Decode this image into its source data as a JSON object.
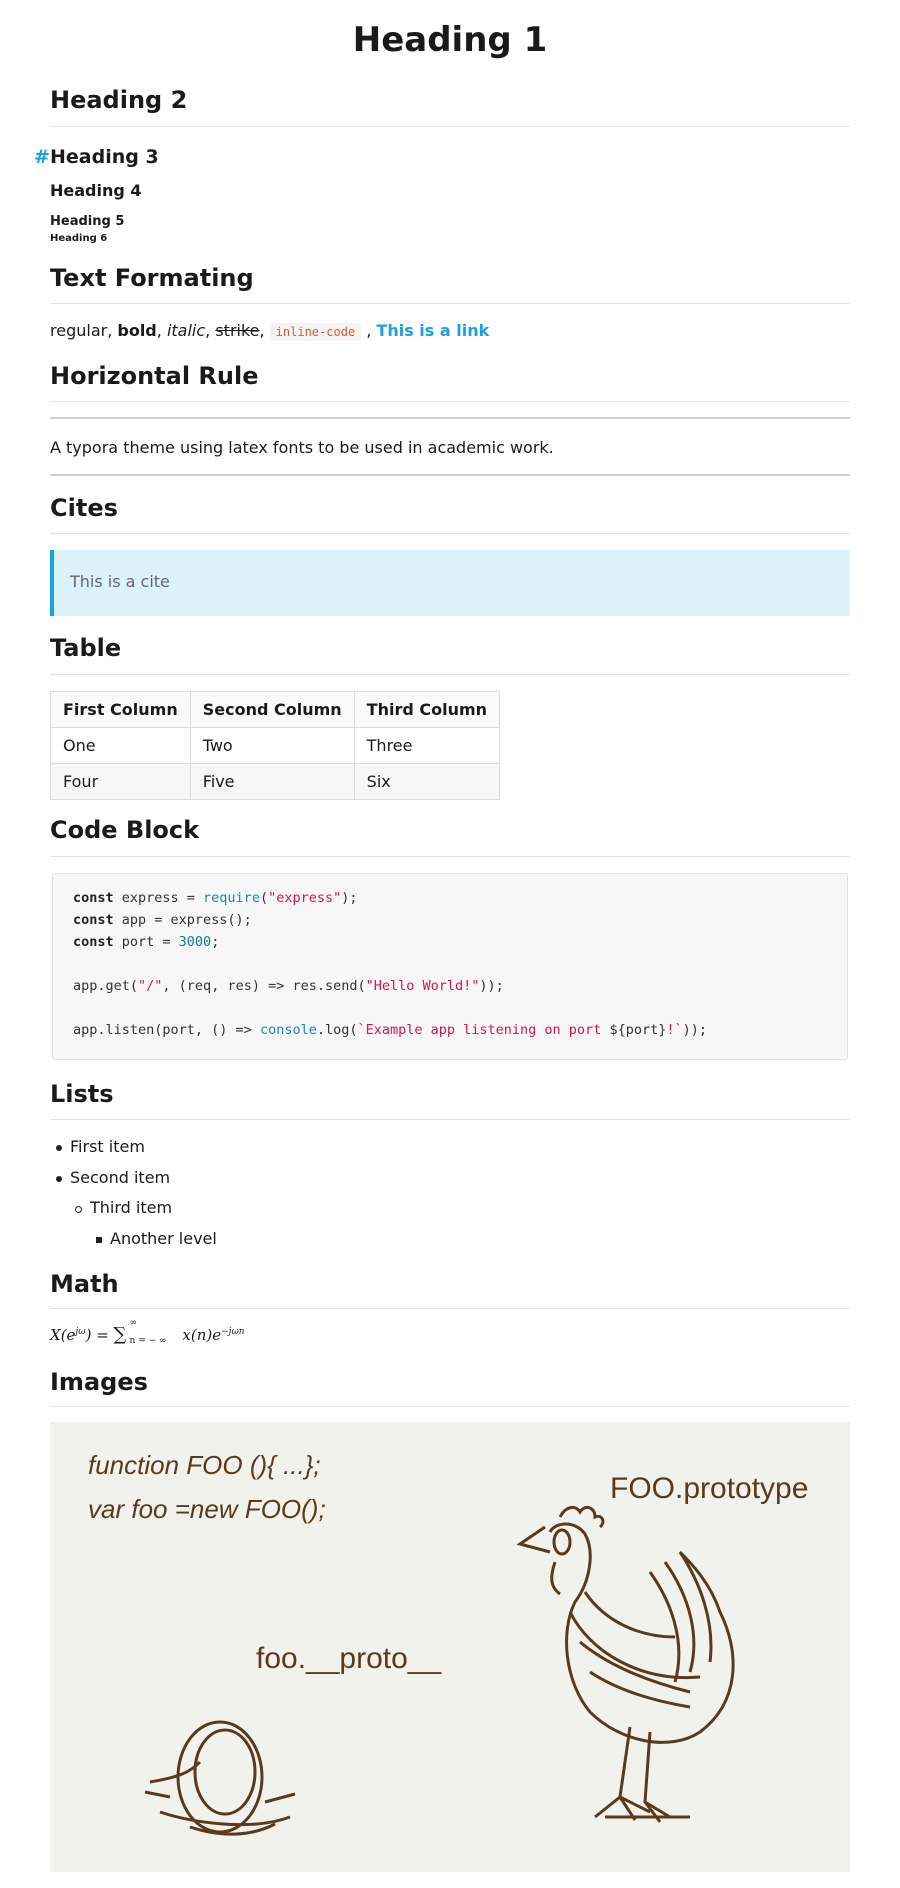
{
  "headings": {
    "h1": "Heading 1",
    "h2": "Heading 2",
    "h3": "Heading 3",
    "h3_anchor": "#",
    "h4": "Heading 4",
    "h5": "Heading 5",
    "h6": "Heading 6"
  },
  "text_formatting": {
    "title": "Text Formating",
    "regular": "regular, ",
    "bold": "bold",
    "sep1": ", ",
    "italic": "italic",
    "sep2": ", ",
    "strike": "strike",
    "sep3": ", ",
    "code": "inline-code",
    "sep4": " , ",
    "link": "This is a link"
  },
  "horizontal_rule": {
    "title": "Horizontal Rule",
    "paragraph": "A typora theme using latex fonts to be used in academic work."
  },
  "cites": {
    "title": "Cites",
    "quote": "This is a cite"
  },
  "table": {
    "title": "Table",
    "headers": [
      "First Column",
      "Second Column",
      "Third Column"
    ],
    "rows": [
      [
        "One",
        "Two",
        "Three"
      ],
      [
        "Four",
        "Five",
        "Six"
      ]
    ]
  },
  "code_block": {
    "title": "Code Block",
    "lines": [
      [
        {
          "t": "const",
          "c": "kw"
        },
        {
          "t": " express = "
        },
        {
          "t": "require",
          "c": "fn"
        },
        {
          "t": "("
        },
        {
          "t": "\"express\"",
          "c": "str"
        },
        {
          "t": ");"
        }
      ],
      [
        {
          "t": "const",
          "c": "kw"
        },
        {
          "t": " app = express();"
        }
      ],
      [
        {
          "t": "const",
          "c": "kw"
        },
        {
          "t": " port = "
        },
        {
          "t": "3000",
          "c": "num"
        },
        {
          "t": ";"
        }
      ],
      [],
      [
        {
          "t": "app.get("
        },
        {
          "t": "\"/\"",
          "c": "str"
        },
        {
          "t": ", (req, res) => res.send("
        },
        {
          "t": "\"Hello World!\"",
          "c": "str"
        },
        {
          "t": "));"
        }
      ],
      [],
      [
        {
          "t": "app.listen(port, () => "
        },
        {
          "t": "console",
          "c": "fn"
        },
        {
          "t": ".log("
        },
        {
          "t": "`Example app listening on port ",
          "c": "str"
        },
        {
          "t": "${port}"
        },
        {
          "t": "!`",
          "c": "str"
        },
        {
          "t": "));"
        }
      ]
    ]
  },
  "lists": {
    "title": "Lists",
    "items": [
      "First item",
      "Second item",
      "Third item",
      "Another level"
    ]
  },
  "math": {
    "title": "Math",
    "X": "X",
    "e_base": "e",
    "jw": "jω",
    "equals": " = ",
    "sum": "∑",
    "infinity": "∞",
    "lower": "n = − ∞",
    "xn": "x(n)e",
    "exp": "−jωn"
  },
  "images": {
    "title": "Images",
    "code_line1": "function FOO (){ ...};",
    "code_line2": "var foo =new FOO();",
    "label_proto": "FOO.prototype",
    "label_dunder": "foo.__proto__"
  }
}
